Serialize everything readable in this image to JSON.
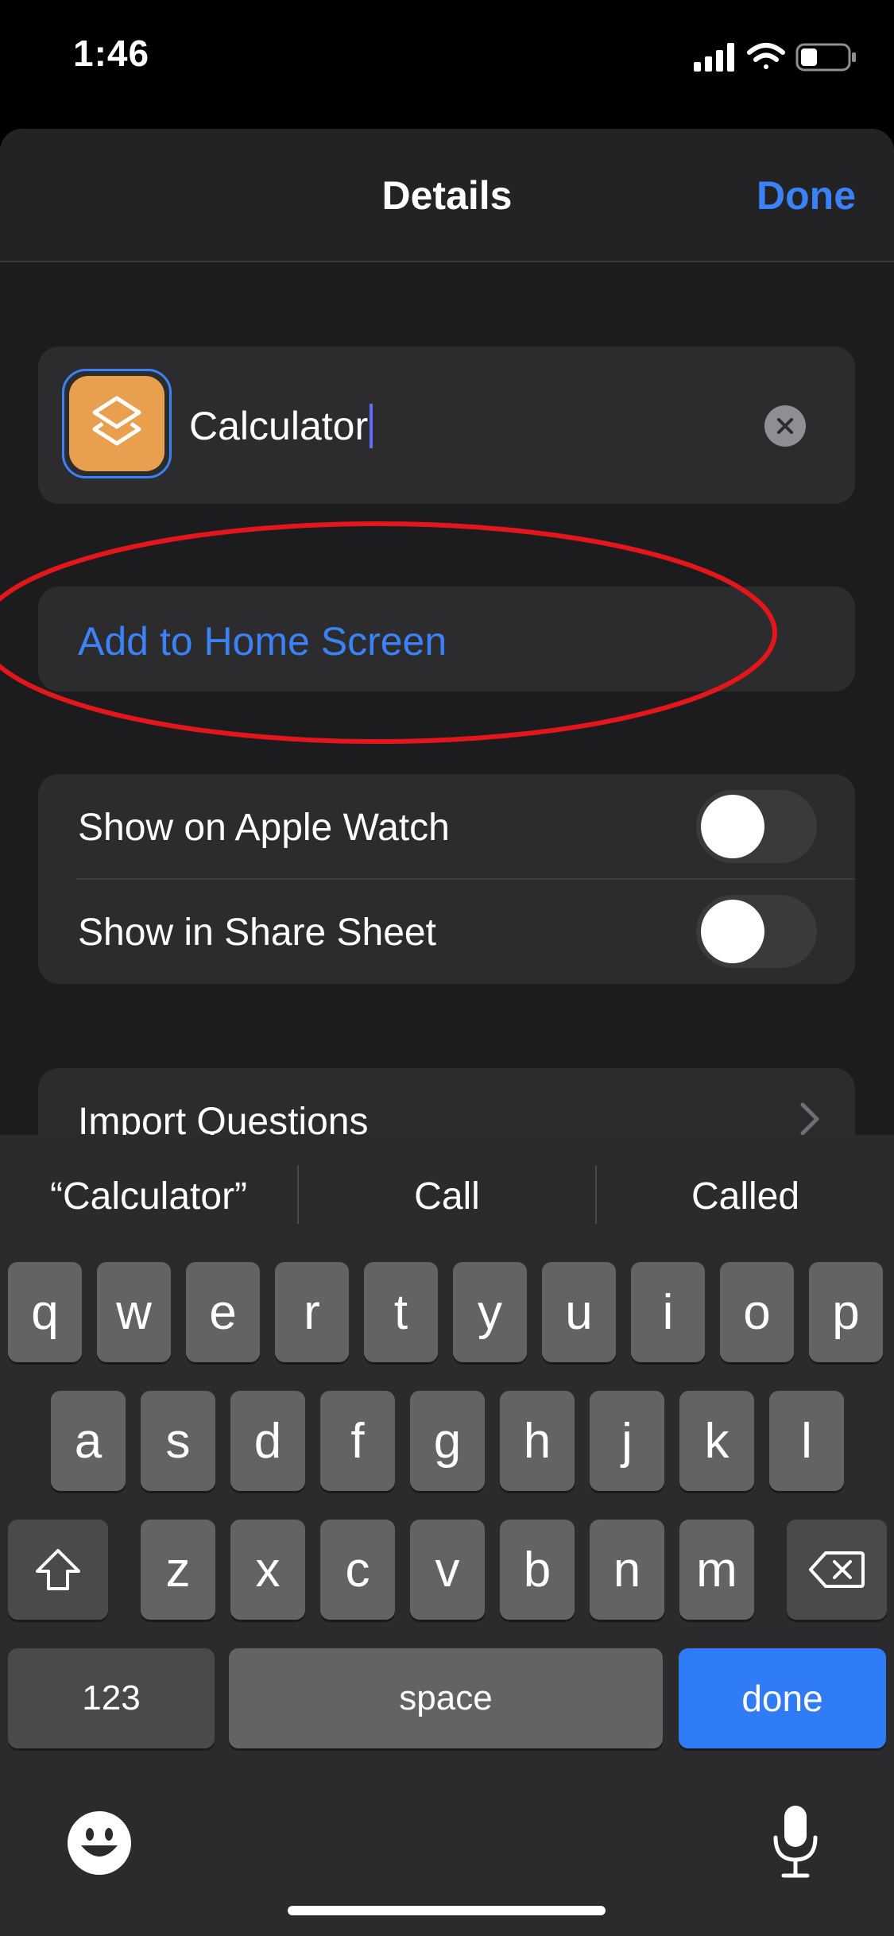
{
  "status": {
    "time": "1:46"
  },
  "nav": {
    "title": "Details",
    "done": "Done"
  },
  "shortcut": {
    "name": "Calculator",
    "icon": "layers-icon",
    "icon_color": "#e9a04e"
  },
  "actions": {
    "add_home": "Add to Home Screen"
  },
  "toggles": [
    {
      "label": "Show on Apple Watch",
      "on": false
    },
    {
      "label": "Show in Share Sheet",
      "on": false
    }
  ],
  "import": {
    "label": "Import Questions"
  },
  "keyboard": {
    "suggestions": [
      "“Calculator”",
      "Call",
      "Called"
    ],
    "row1": [
      "q",
      "w",
      "e",
      "r",
      "t",
      "y",
      "u",
      "i",
      "o",
      "p"
    ],
    "row2": [
      "a",
      "s",
      "d",
      "f",
      "g",
      "h",
      "j",
      "k",
      "l"
    ],
    "row3": [
      "z",
      "x",
      "c",
      "v",
      "b",
      "n",
      "m"
    ],
    "numbers": "123",
    "space": "space",
    "done": "done"
  },
  "colors": {
    "accent": "#3b82f6",
    "annotation": "#e3161c"
  }
}
